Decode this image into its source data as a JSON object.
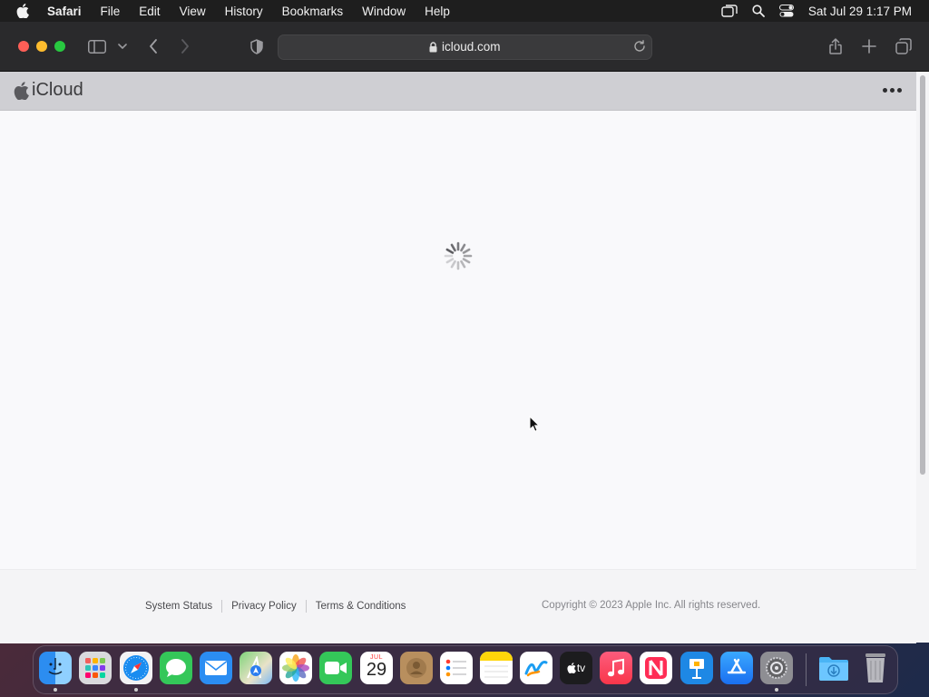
{
  "menubar": {
    "app_name": "Safari",
    "items": [
      "File",
      "Edit",
      "View",
      "History",
      "Bookmarks",
      "Window",
      "Help"
    ],
    "clock": "Sat Jul 29  1:17 PM"
  },
  "toolbar": {
    "url": "icloud.com"
  },
  "icloud": {
    "brand": "iCloud"
  },
  "footer": {
    "links": [
      "System Status",
      "Privacy Policy",
      "Terms & Conditions"
    ],
    "copyright": "Copyright © 2023 Apple Inc. All rights reserved."
  },
  "dock": {
    "calendar_month": "JUL",
    "calendar_day": "29",
    "tv_label": "tv",
    "apps": [
      "Finder",
      "Launchpad",
      "Safari",
      "Messages",
      "Mail",
      "Maps",
      "Photos",
      "FaceTime",
      "Calendar",
      "Contacts",
      "Reminders",
      "Notes",
      "Freeform",
      "TV",
      "Music",
      "News",
      "Keynote",
      "App Store",
      "System Settings",
      "Downloads",
      "Trash"
    ]
  }
}
